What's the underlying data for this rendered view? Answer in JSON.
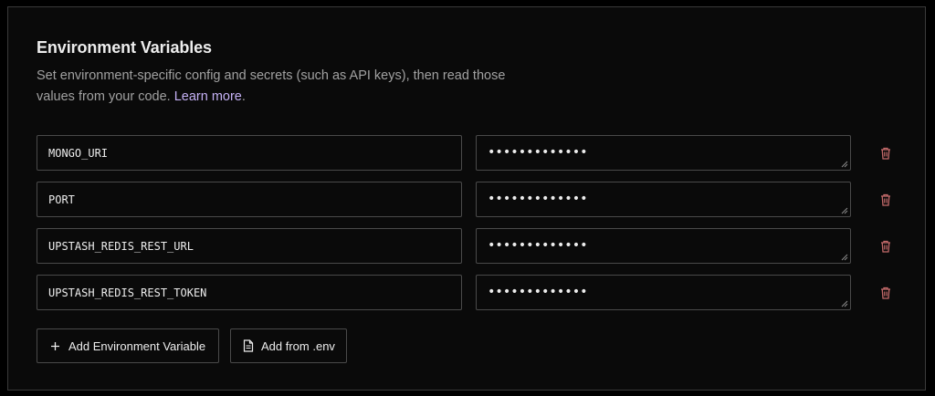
{
  "section": {
    "title": "Environment Variables",
    "description_line1": "Set environment-specific config and secrets (such as API keys), then read those",
    "description_line2": "values from your code.",
    "learn_more": "Learn more",
    "period": "."
  },
  "variables": [
    {
      "key": "MONGO_URI",
      "value_masked": "•••••••••••••"
    },
    {
      "key": "PORT",
      "value_masked": "•••••••••••••"
    },
    {
      "key": "UPSTASH_REDIS_REST_URL",
      "value_masked": "•••••••••••••"
    },
    {
      "key": "UPSTASH_REDIS_REST_TOKEN",
      "value_masked": "•••••••••••••"
    }
  ],
  "actions": {
    "add_variable_label": "Add Environment Variable",
    "add_from_env_label": "Add from .env"
  },
  "icons": {
    "delete": "trash-icon",
    "add": "plus-icon",
    "file": "file-icon"
  },
  "colors": {
    "background": "#000000",
    "panel": "#0a0a0a",
    "border": "#4a4a4a",
    "link": "#c5b1f5",
    "delete_icon": "#c46a6a",
    "muted_text": "#a1a1a1"
  }
}
